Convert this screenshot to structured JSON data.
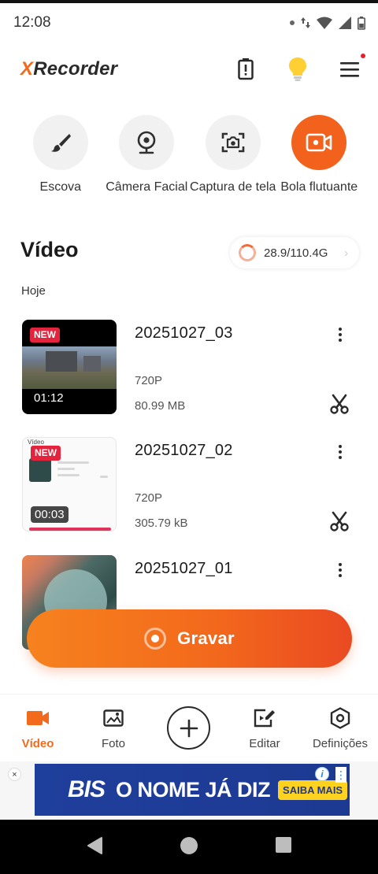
{
  "status_bar": {
    "time": "12:08"
  },
  "header": {
    "brand_x": "X",
    "brand_rest": "Recorder"
  },
  "tools": [
    {
      "label": "Escova",
      "icon": "brush-icon"
    },
    {
      "label": "Câmera Facial",
      "icon": "webcam-icon"
    },
    {
      "label": "Captura de tela",
      "icon": "screenshot-icon"
    },
    {
      "label": "Bola flutuante",
      "icon": "floating-ball-icon"
    }
  ],
  "video_section": {
    "title": "Vídeo",
    "storage": "28.9/110.4G",
    "date_group": "Hoje"
  },
  "videos": [
    {
      "name": "20251027_03",
      "resolution": "720P",
      "size": "80.99 MB",
      "duration": "01:12",
      "badge": "NEW"
    },
    {
      "name": "20251027_02",
      "resolution": "720P",
      "size": "305.79 kB",
      "duration": "00:03",
      "badge": "NEW"
    },
    {
      "name": "20251027_01"
    }
  ],
  "thumb2_mini_title": "Vídeo",
  "record_button": {
    "label": "Gravar"
  },
  "bottom_nav": [
    {
      "label": "Vídeo",
      "active": true
    },
    {
      "label": "Foto"
    },
    {
      "label": "Editar"
    },
    {
      "label": "Definições"
    }
  ],
  "ad": {
    "logo": "BIS",
    "text": "O NOME JÁ DIZ",
    "cta": "SAIBA MAIS",
    "close": "×",
    "info": "i"
  },
  "colors": {
    "accent": "#F26A1B",
    "new_badge": "#E3243C",
    "ad_bg": "#1F3F9C",
    "ad_cta": "#FFD21F"
  }
}
